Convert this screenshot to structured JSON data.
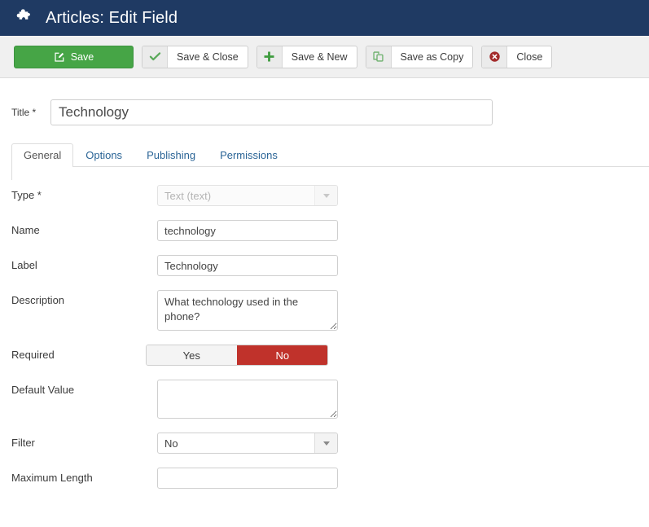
{
  "header": {
    "icon": "puzzle-piece-icon",
    "title": "Articles: Edit Field"
  },
  "toolbar": {
    "buttons": [
      {
        "label": "Save",
        "icon": "edit-pencil-icon",
        "style": "primary-green"
      },
      {
        "label": "Save & Close",
        "icon": "check-icon",
        "style": "default"
      },
      {
        "label": "Save & New",
        "icon": "plus-icon",
        "style": "default"
      },
      {
        "label": "Save as Copy",
        "icon": "copy-icon",
        "style": "default"
      },
      {
        "label": "Close",
        "icon": "cancel-circle-icon",
        "style": "default"
      }
    ],
    "colors": {
      "save_green": "#46a546",
      "plus_green": "#3f9c3f",
      "check_green": "#5aa95a",
      "copy_green": "#6bb06b",
      "close_red": "#a32b2b"
    }
  },
  "title_field": {
    "label": "Title *",
    "value": "Technology"
  },
  "tabs": [
    {
      "label": "General",
      "active": true
    },
    {
      "label": "Options",
      "active": false
    },
    {
      "label": "Publishing",
      "active": false
    },
    {
      "label": "Permissions",
      "active": false
    }
  ],
  "form": {
    "type": {
      "label": "Type *",
      "value": "Text (text)",
      "disabled": true
    },
    "name": {
      "label": "Name",
      "value": "technology"
    },
    "label_field": {
      "label": "Label",
      "value": "Technology"
    },
    "description": {
      "label": "Description",
      "value": "What technology used in the phone?"
    },
    "required": {
      "label": "Required",
      "options": [
        "Yes",
        "No"
      ],
      "selected": "No",
      "selected_color": "#c0322b"
    },
    "default_value": {
      "label": "Default Value",
      "value": ""
    },
    "filter": {
      "label": "Filter",
      "value": "No"
    },
    "maximum_length": {
      "label": "Maximum Length",
      "value": ""
    }
  }
}
